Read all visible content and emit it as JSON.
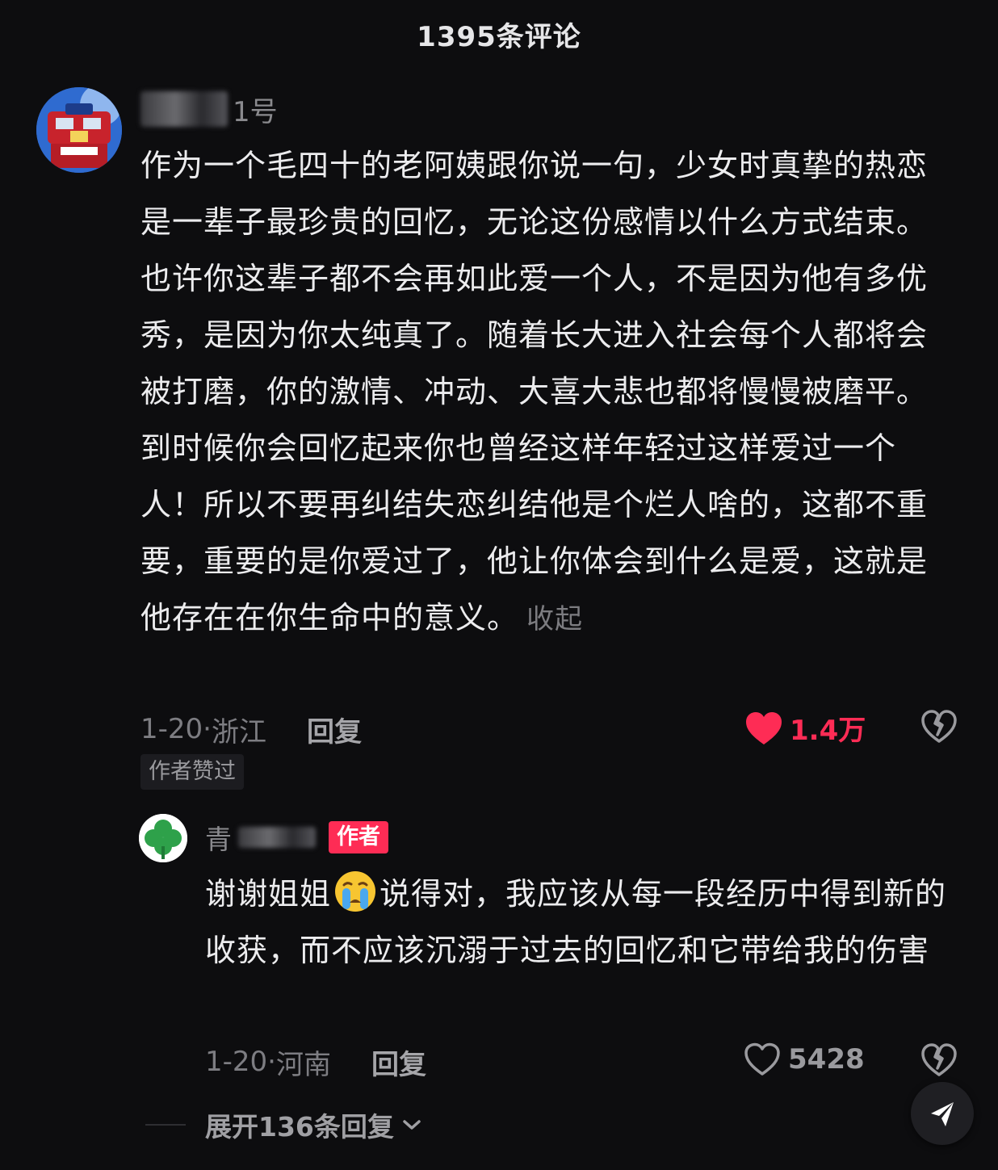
{
  "header": {
    "title": "1395条评论"
  },
  "main_comment": {
    "username_visible": "1号",
    "text": "作为一个毛四十的老阿姨跟你说一句，少女时真挚的热恋是一辈子最珍贵的回忆，无论这份感情以什么方式结束。也许你这辈子都不会再如此爱一个人，不是因为他有多优秀，是因为你太纯真了。随着长大进入社会每个人都将会被打磨，你的激情、冲动、大喜大悲也都将慢慢被磨平。到时候你会回忆起来你也曾经这样年轻过这样爱过一个人！所以不要再纠结失恋纠结他是个烂人啥的，这都不重要，重要的是你爱过了，他让你体会到什么是爱，这就是他存在在你生命中的意义。",
    "collapse_label": "收起",
    "date": "1-20",
    "location": "浙江",
    "reply_label": "回复",
    "likes": "1.4万",
    "liked": true,
    "author_liked_tag": "作者赞过",
    "avatar_icon": "robot-avatar-icon"
  },
  "reply": {
    "username_visible": "青",
    "author_badge": "作者",
    "text_before_emoji": "谢谢姐姐",
    "emoji": "crying-face-emoji",
    "text_after_emoji": "说得对，我应该从每一段经历中得到新的收获，而不应该沉溺于过去的回忆和它带给我的伤害",
    "date": "1-20",
    "location": "河南",
    "reply_label": "回复",
    "likes": "5428",
    "liked": false,
    "avatar_icon": "clover-avatar-icon"
  },
  "expand": {
    "label": "展开136条回复"
  },
  "colors": {
    "background": "#0d0d0f",
    "like_red": "#fe2c55",
    "author_badge": "#fe2c55",
    "muted_text": "#7d7d82"
  }
}
